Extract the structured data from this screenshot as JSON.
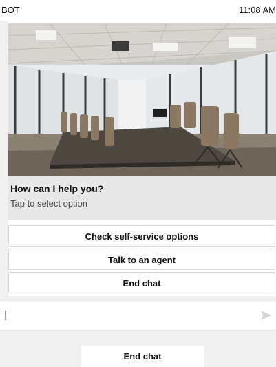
{
  "status_bar": {
    "carrier": "BOT",
    "time": "11:08 AM"
  },
  "card": {
    "image": {
      "icon": "conference-room-photo"
    },
    "prompt": {
      "title": "How can I help you?",
      "subtitle": "Tap to select option"
    },
    "options": [
      "Check self-service options",
      "Talk to an agent",
      "End chat"
    ]
  },
  "composer": {
    "value": "",
    "send_icon": "send-arrow-icon"
  },
  "bottom_button": {
    "label": "End chat"
  }
}
